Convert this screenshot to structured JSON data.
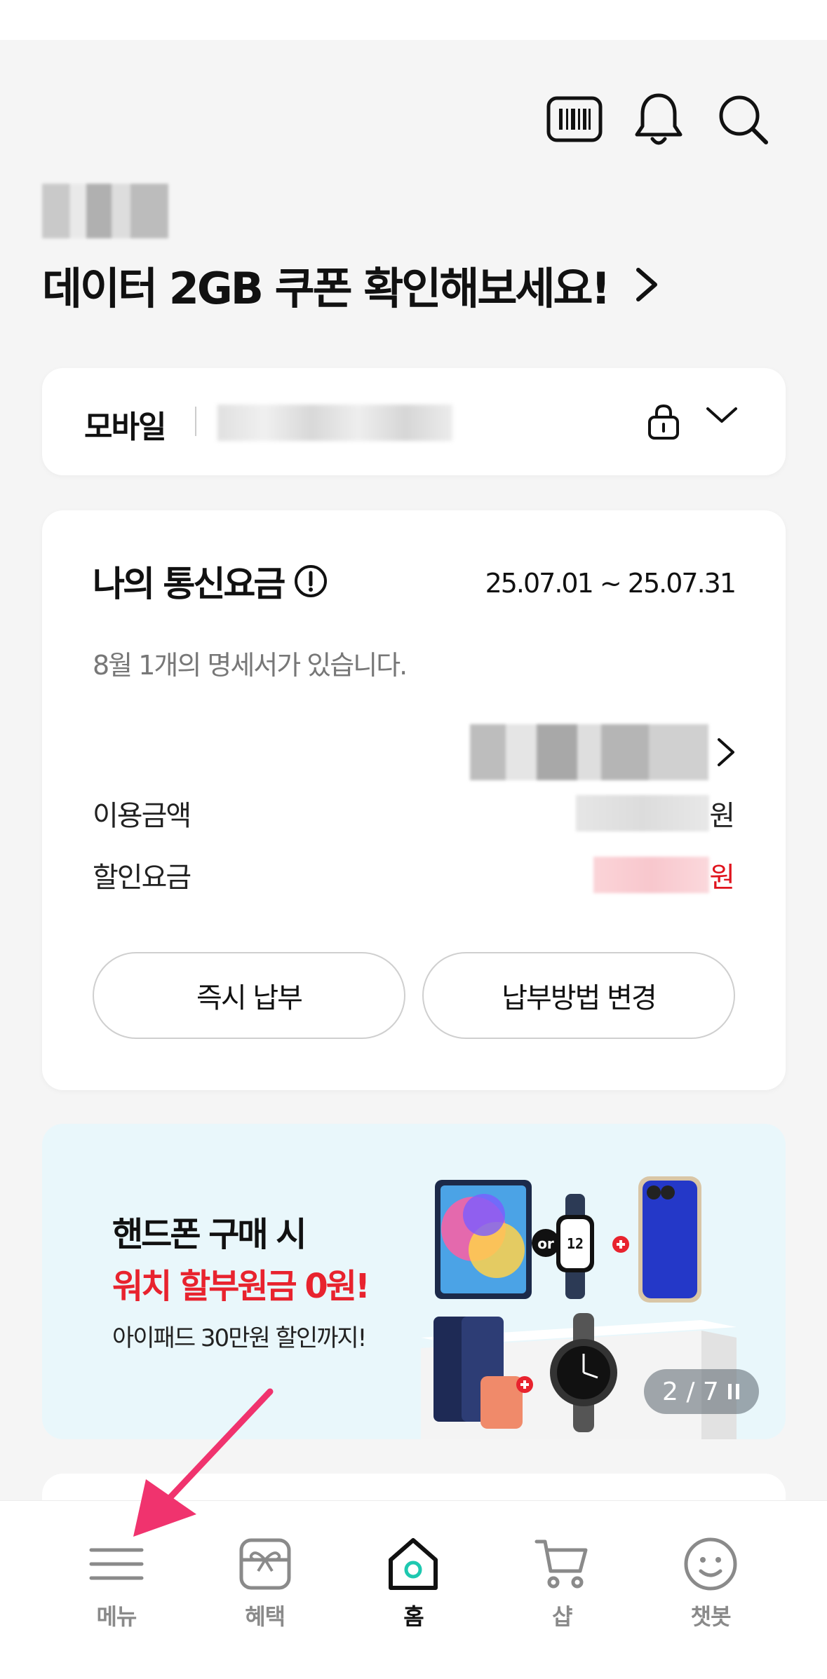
{
  "header": {
    "icons": [
      "barcode-icon",
      "bell-icon",
      "search-icon"
    ],
    "headline": "데이터 2GB 쿠폰 확인해보세요!"
  },
  "line_selector": {
    "label": "모바일"
  },
  "bill": {
    "title": "나의 통신요금",
    "period": "25.07.01 ~ 25.07.31",
    "notice": "8월 1개의 명세서가 있습니다.",
    "usage_label": "이용금액",
    "discount_label": "할인요금",
    "currency": "원",
    "pay_now": "즉시 납부",
    "change_method": "납부방법 변경",
    "discount_color": "#e0141e"
  },
  "banner": {
    "line1": "핸드폰 구매 시",
    "line2": "워치 할부원금 0원!",
    "line3": "아이패드 30만원 할인까지!",
    "pager": "2 / 7",
    "accent": "#e8232e"
  },
  "tabbar": {
    "menu": "메뉴",
    "benefits": "혜택",
    "home": "홈",
    "shop": "샵",
    "chatbot": "챗봇",
    "active_color": "#111111",
    "home_accent": "#1ec8b0"
  },
  "annotation": {
    "arrow_color": "#f0336e"
  }
}
